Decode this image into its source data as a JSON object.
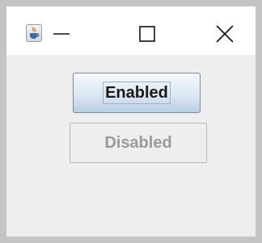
{
  "window": {
    "controls": {
      "minimize_icon": "minimize-icon",
      "maximize_icon": "maximize-icon",
      "close_icon": "close-icon"
    },
    "app_icon": "java-coffee-cup-icon"
  },
  "buttons": {
    "enabled_label": "Enabled",
    "disabled_label": "Disabled"
  },
  "colors": {
    "enabled_button_top": "#f5f8fb",
    "enabled_button_bottom": "#b8cfe5",
    "disabled_text": "#9a9a9a",
    "content_background": "#eeeeee",
    "frame_border": "#c4c4c4"
  }
}
